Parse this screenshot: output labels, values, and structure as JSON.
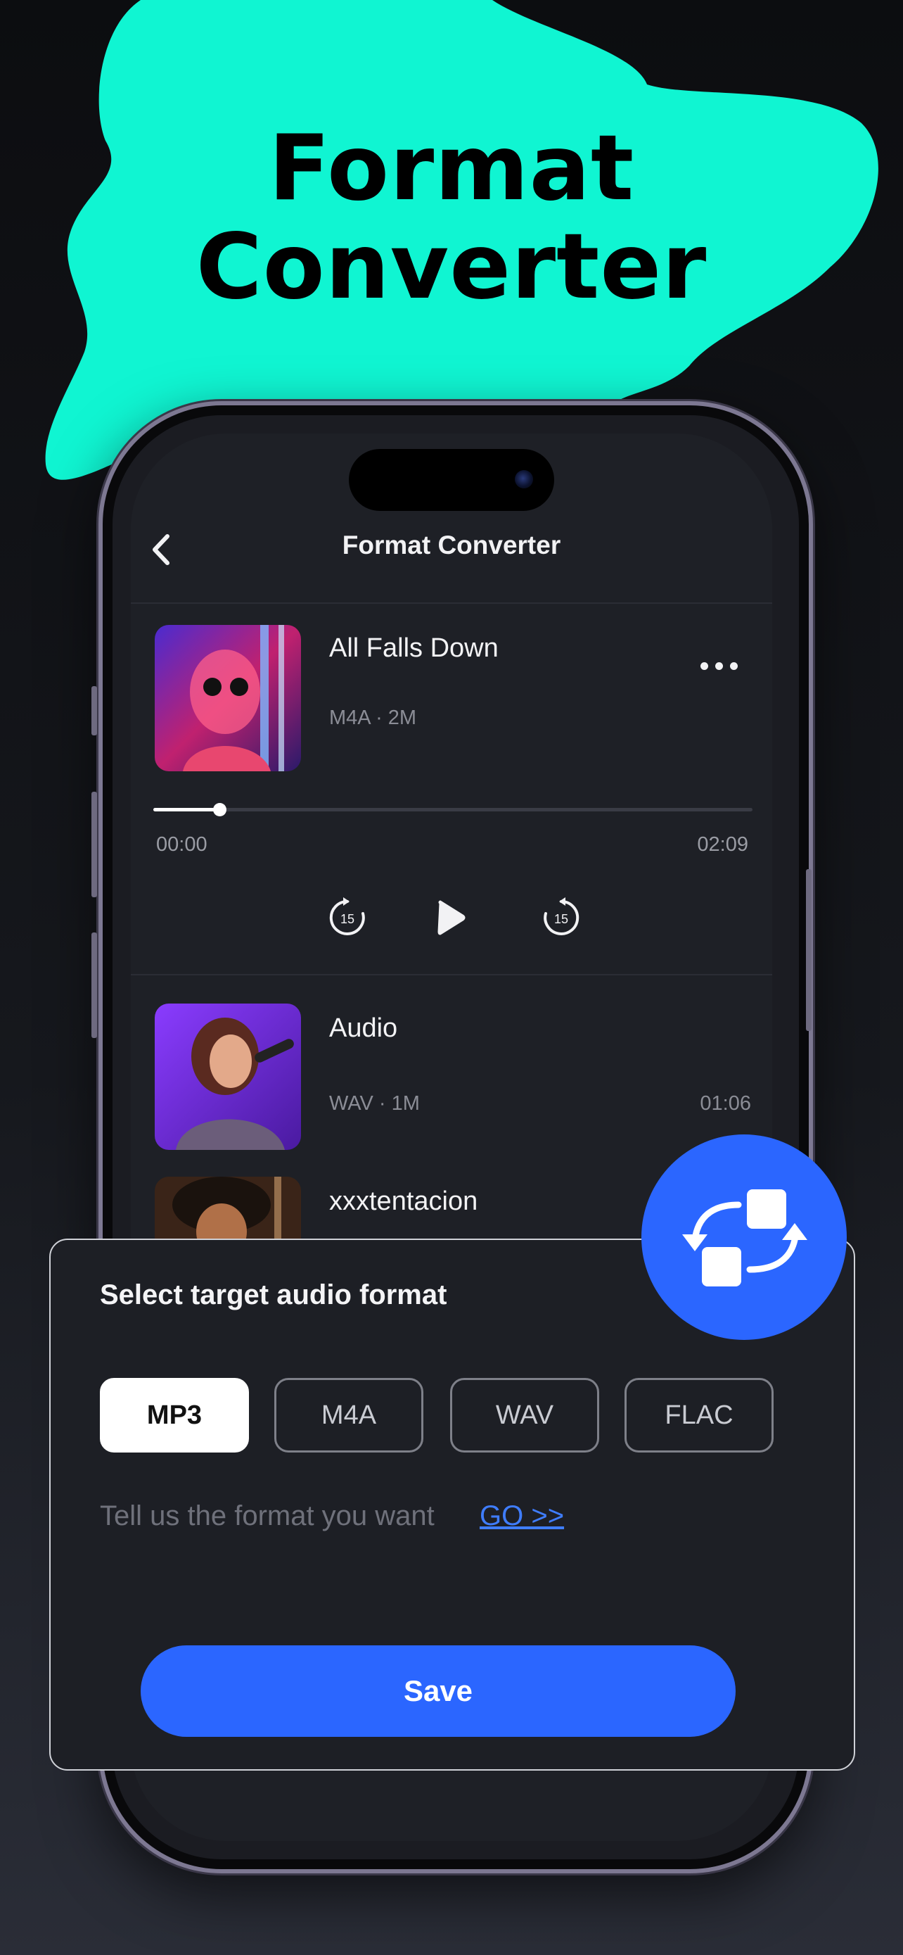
{
  "colors": {
    "accent_mint": "#10f5d2",
    "primary_blue": "#2b66ff",
    "link_blue": "#3f7dff",
    "background": "#111216"
  },
  "headline": {
    "line1": "Format",
    "line2": "Converter"
  },
  "nav": {
    "title": "Format Converter",
    "back_icon": "chevron-left-icon"
  },
  "now_playing": {
    "title": "All Falls Down",
    "meta": "M4A · 2M",
    "more_icon": "ellipsis-icon",
    "time_current": "00:00",
    "time_total": "02:09",
    "progress_fraction": 0.11,
    "controls": {
      "rewind_label": "15",
      "forward_label": "15",
      "rewind_icon": "rewind-15-icon",
      "play_icon": "play-icon",
      "forward_icon": "forward-15-icon"
    }
  },
  "list": [
    {
      "title": "Audio",
      "meta": "WAV · 1M",
      "duration": "01:06"
    },
    {
      "title": "xxxtentacion"
    }
  ],
  "sheet": {
    "title": "Select target audio format",
    "formats": [
      {
        "label": "MP3",
        "selected": true
      },
      {
        "label": "M4A",
        "selected": false
      },
      {
        "label": "WAV",
        "selected": false
      },
      {
        "label": "FLAC",
        "selected": false
      }
    ],
    "hint": "Tell us the format you want",
    "hint_link": "GO >>",
    "save_label": "Save"
  },
  "fab_icon": "convert-swap-icon"
}
